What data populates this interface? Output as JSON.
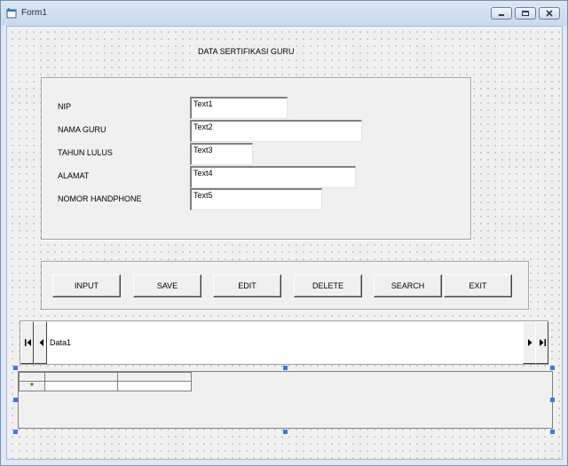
{
  "window": {
    "title": "Form1",
    "icon": "form-app-icon"
  },
  "form": {
    "caption": "DATA SERTIFIKASI GURU",
    "fields": [
      {
        "label": "NIP",
        "value": "Text1"
      },
      {
        "label": "NAMA GURU",
        "value": "Text2"
      },
      {
        "label": "TAHUN LULUS",
        "value": "Text3"
      },
      {
        "label": "ALAMAT",
        "value": "Text4"
      },
      {
        "label": "NOMOR HANDPHONE",
        "value": "Text5"
      }
    ]
  },
  "buttons": [
    "INPUT",
    "SAVE",
    "EDIT",
    "DELETE",
    "SEARCH",
    "EXIT"
  ],
  "data_control": {
    "caption": "Data1"
  },
  "grid": {
    "new_row_marker": "*"
  }
}
